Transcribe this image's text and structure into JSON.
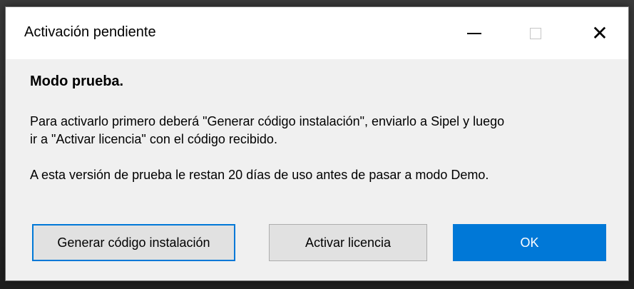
{
  "window": {
    "title": "Activación pendiente",
    "controls": {
      "minimize_icon": "minimize-icon",
      "maximize_icon": "maximize-icon",
      "close_icon": "close-icon",
      "close_glyph": "✕"
    }
  },
  "dialog": {
    "heading": "Modo prueba.",
    "message": "Para activarlo primero deberá \"Generar código instalación\", enviarlo a Sipel y luego\nir a \"Activar licencia\" con el código recibido.",
    "trial_notice": "A esta versión de prueba le restan 20 días de uso antes de pasar a modo Demo."
  },
  "buttons": {
    "generate": "Generar código instalación",
    "activate": "Activar licencia",
    "ok": "OK"
  },
  "colors": {
    "accent": "#0078d7",
    "dialog_bg": "#f0f0f0",
    "button_bg": "#e1e1e1"
  }
}
